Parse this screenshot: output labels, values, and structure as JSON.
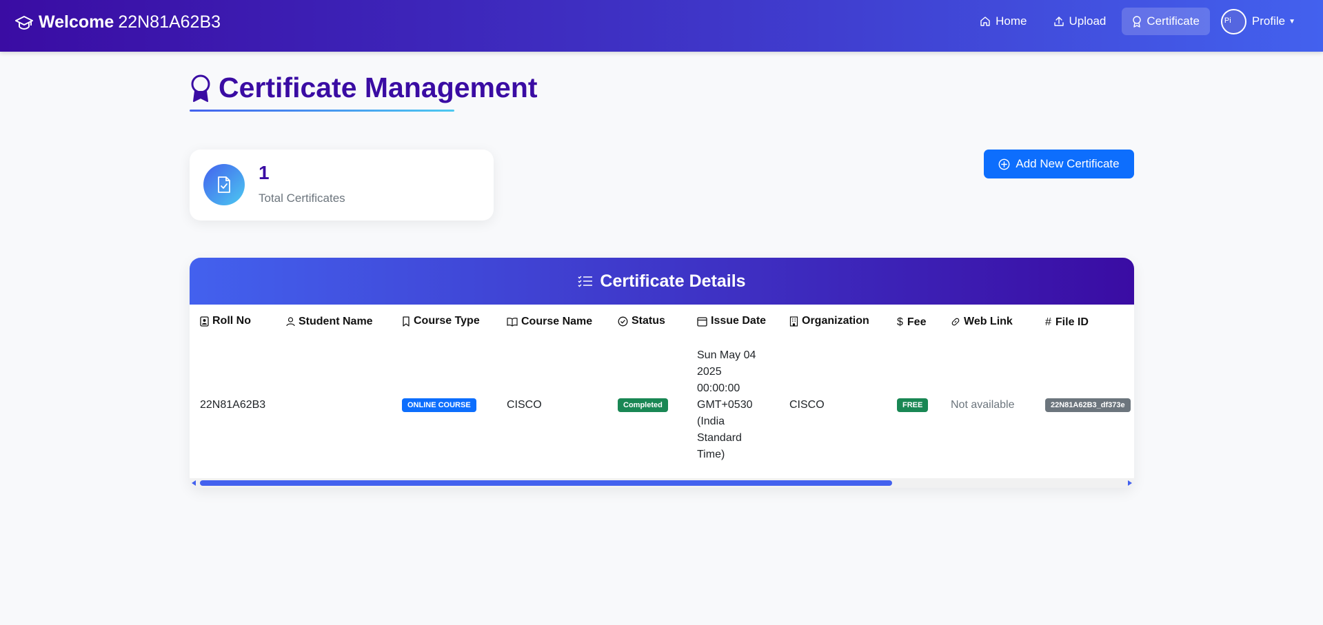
{
  "navbar": {
    "welcome": "Welcome",
    "user_id": "22N81A62B3",
    "links": {
      "home": "Home",
      "upload": "Upload",
      "certificate": "Certificate"
    },
    "profile_label": "Profile",
    "avatar_alt": "Pi"
  },
  "page": {
    "title": "Certificate Management"
  },
  "stats": {
    "total_value": "1",
    "total_label": "Total Certificates"
  },
  "actions": {
    "add_label": "Add New Certificate"
  },
  "table": {
    "title": "Certificate Details",
    "headers": {
      "roll_no": "Roll No",
      "student_name": "Student Name",
      "course_type": "Course Type",
      "course_name": "Course Name",
      "status": "Status",
      "issue_date": "Issue Date",
      "organization": "Organization",
      "fee": "Fee",
      "web_link": "Web Link",
      "file_id": "File ID"
    },
    "rows": [
      {
        "roll_no": "22N81A62B3",
        "student_name": "",
        "course_type": "ONLINE COURSE",
        "course_name": "CISCO",
        "status": "Completed",
        "issue_date": "Sun May 04 2025 00:00:00 GMT+0530 (India Standard Time)",
        "organization": "CISCO",
        "fee": "FREE",
        "web_link": "Not available",
        "file_id": "22N81A62B3_df373e"
      }
    ]
  },
  "colors": {
    "brand_dark": "#3a0ca3",
    "brand_blue": "#4361ee",
    "primary_button": "#0d6efd",
    "success": "#198754",
    "secondary": "#6c757d"
  }
}
